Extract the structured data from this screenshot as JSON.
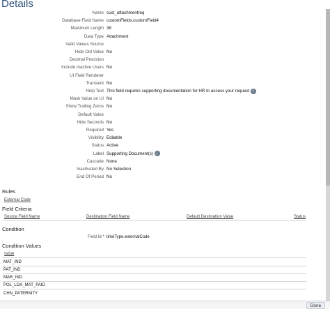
{
  "title": "Details",
  "fields": [
    {
      "label": "Name",
      "value": "cust_attachmentreq"
    },
    {
      "label": "Database Field Name",
      "value": "customFields.customField4"
    },
    {
      "label": "Maximum Length",
      "value": "38"
    },
    {
      "label": "Data Type",
      "value": "Attachment"
    },
    {
      "label": "Valid Values Source",
      "value": ""
    },
    {
      "label": "Hide Old Value",
      "value": "No"
    },
    {
      "label": "Decimal Precision",
      "value": ""
    },
    {
      "label": "Include Inactive Users",
      "value": "No"
    },
    {
      "label": "UI Field Renderer",
      "value": ""
    },
    {
      "label": "Transient",
      "value": "No"
    },
    {
      "label": "Help Text",
      "value": "This field requires supporting documentation for HR to assess your request",
      "icon": "info-icon"
    },
    {
      "label": "Mask Value on UI",
      "value": "No"
    },
    {
      "label": "Show Trailing Zeros",
      "value": "No"
    },
    {
      "label": "Default Value",
      "value": ""
    },
    {
      "label": "Hide Seconds",
      "value": "No"
    },
    {
      "label": "Required",
      "value": "Yes"
    },
    {
      "label": "Visibility",
      "value": "Editable"
    },
    {
      "label": "Status",
      "value": "Active"
    },
    {
      "label": "Label",
      "value": "Supporting Document(s)",
      "icon": "info-icon"
    },
    {
      "label": "Cascade",
      "value": "None"
    },
    {
      "label": "Inactivated By",
      "value": "No Selection"
    },
    {
      "label": "End Of Period",
      "value": "No"
    }
  ],
  "rules": {
    "title": "Rules",
    "external_code_link": "External Code"
  },
  "field_criteria": {
    "title": "Field Criteria",
    "headers": [
      "Source Field Name",
      "Destination Field Name",
      "Default Destination Value",
      "Status"
    ]
  },
  "condition": {
    "title": "Condition",
    "field_label": "Field Id *",
    "field_value": "timeType.externalCode"
  },
  "condition_values": {
    "title": "Condition Values",
    "header": "value",
    "values": [
      "MAT_IND",
      "PAT_IND",
      "MAR_IND",
      "POL_LOA_MAT_PAID",
      "CHN_PATERNITY"
    ]
  },
  "footer": {
    "done_label": "Done"
  }
}
